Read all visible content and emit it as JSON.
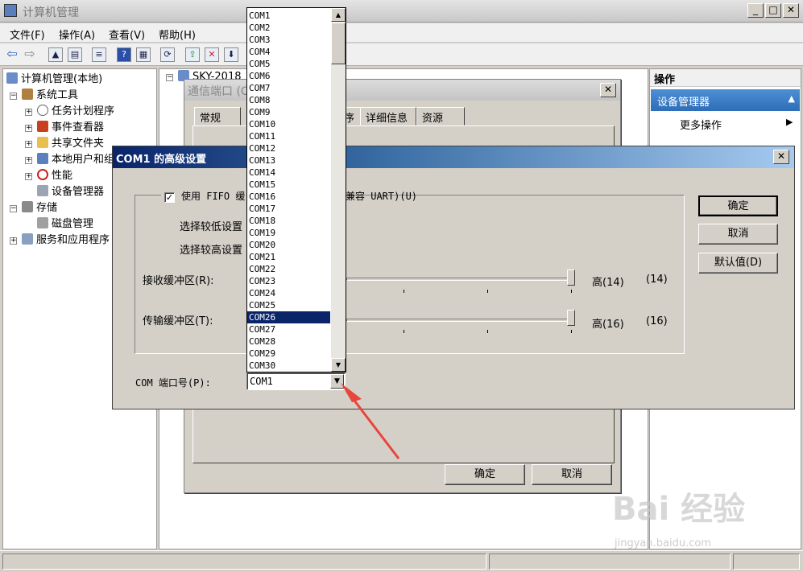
{
  "main_window": {
    "title": "计算机管理",
    "menu": [
      "文件(F)",
      "操作(A)",
      "查看(V)",
      "帮助(H)"
    ]
  },
  "tree": {
    "root": "计算机管理(本地)",
    "items": [
      {
        "label": "系统工具",
        "level": 1,
        "expand": "⊟"
      },
      {
        "label": "任务计划程序",
        "level": 2,
        "expand": "⊞"
      },
      {
        "label": "事件查看器",
        "level": 2,
        "expand": "⊞"
      },
      {
        "label": "共享文件夹",
        "level": 2,
        "expand": "⊞"
      },
      {
        "label": "本地用户和组",
        "level": 2,
        "expand": "⊞"
      },
      {
        "label": "性能",
        "level": 2,
        "expand": "⊞"
      },
      {
        "label": "设备管理器",
        "level": 2,
        "expand": ""
      },
      {
        "label": "存储",
        "level": 1,
        "expand": "⊟"
      },
      {
        "label": "磁盘管理",
        "level": 2,
        "expand": ""
      },
      {
        "label": "服务和应用程序",
        "level": 1,
        "expand": "⊞"
      }
    ]
  },
  "center": {
    "node": "SKY-2018"
  },
  "actions": {
    "header": "操作",
    "selected": "设备管理器",
    "more": "更多操作"
  },
  "props_dialog": {
    "title": "通信端口 (C",
    "tabs": [
      "常规",
      "序",
      "详细信息",
      "资源"
    ],
    "ok": "确定",
    "cancel": "取消"
  },
  "adv_dialog": {
    "title": "COM1 的高级设置",
    "fifo_label": "使用 FIFO 缓",
    "fifo_tail": "兼容 UART)(U)",
    "fifo_checked": true,
    "low_label": "选择较低设置",
    "high_label": "选择较高设置",
    "rx_label": "接收缓冲区(R):",
    "rx_value_text": "高(14)",
    "rx_value": "(14)",
    "tx_label": "传输缓冲区(T):",
    "tx_value_text": "高(16)",
    "tx_value": "(16)",
    "port_label": "COM 端口号(P):",
    "port_value": "COM1",
    "ok": "确定",
    "cancel": "取消",
    "defaults": "默认值(D)"
  },
  "dropdown": {
    "options": [
      "COM1",
      "COM2",
      "COM3",
      "COM4",
      "COM5",
      "COM6",
      "COM7",
      "COM8",
      "COM9",
      "COM10",
      "COM11",
      "COM12",
      "COM13",
      "COM14",
      "COM15",
      "COM16",
      "COM17",
      "COM18",
      "COM19",
      "COM20",
      "COM21",
      "COM22",
      "COM23",
      "COM24",
      "COM25",
      "COM26",
      "COM27",
      "COM28",
      "COM29",
      "COM30"
    ],
    "highlighted": "COM26"
  },
  "watermark": {
    "brand": "Bai 经验",
    "url": "jingyan.baidu.com"
  },
  "colors": {
    "selection": "#0a246a",
    "accent": "#2e6db7",
    "arrow": "#e8453c"
  }
}
